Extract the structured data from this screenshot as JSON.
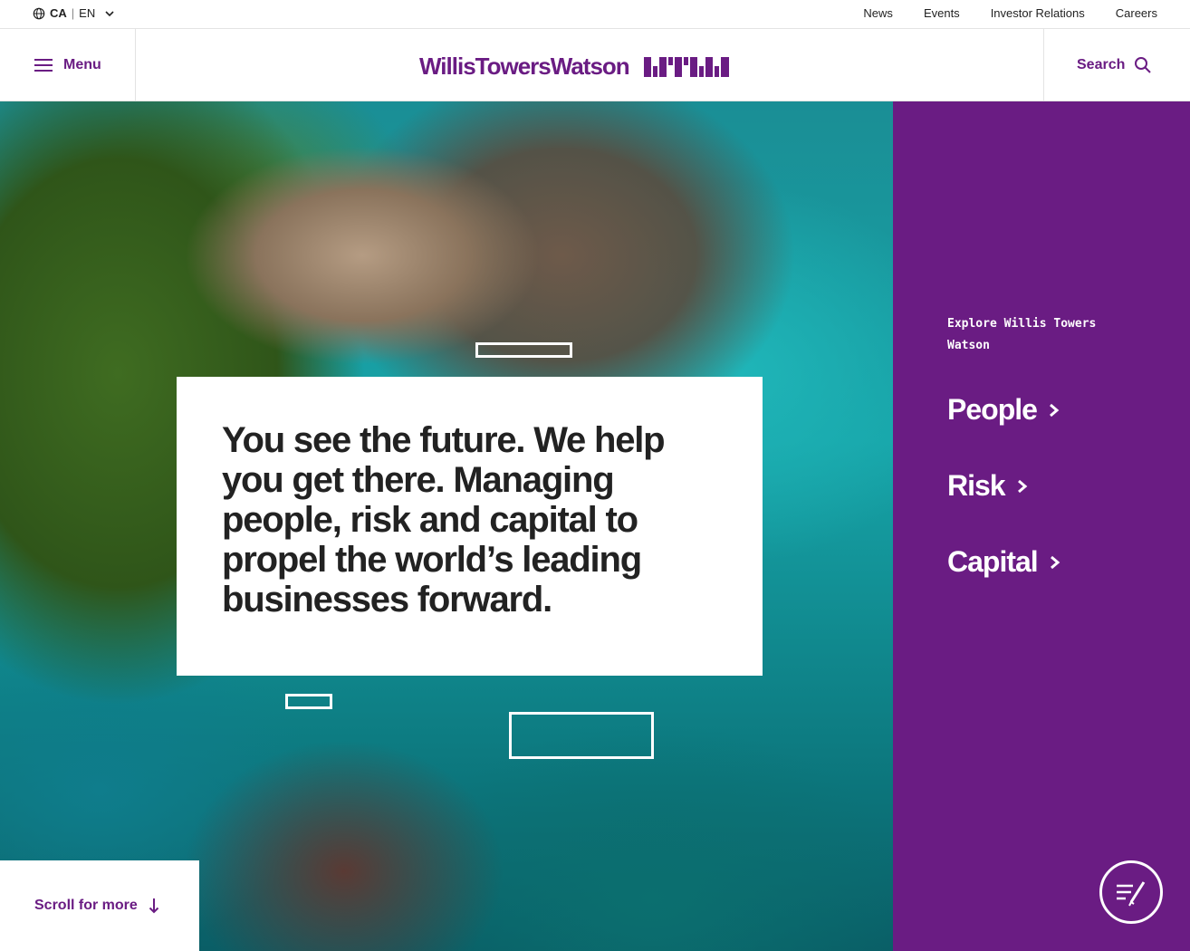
{
  "utility": {
    "locale_current": "CA",
    "locale_language": "EN",
    "links": [
      "News",
      "Events",
      "Investor Relations",
      "Careers"
    ]
  },
  "header": {
    "menu_label": "Menu",
    "logo_text": "WillisTowersWatson",
    "search_label": "Search"
  },
  "hero": {
    "headline": "You see the future. We help you get there. Managing people, risk and capital to propel the world’s leading businesses forward.",
    "scroll_label": "Scroll for more"
  },
  "explore": {
    "heading": "Explore Willis Towers Watson",
    "links": [
      "People",
      "Risk",
      "Capital"
    ]
  },
  "colors": {
    "brand_purple": "#6a1c83",
    "text_dark": "#222222"
  },
  "icons": {
    "locale": "globe-icon",
    "locale_toggle": "chevron-down-icon",
    "menu": "hamburger-icon",
    "search": "search-icon",
    "scroll": "arrow-down-icon",
    "explore_arrow": "chevron-right-icon",
    "feedback": "feedback-icon"
  }
}
